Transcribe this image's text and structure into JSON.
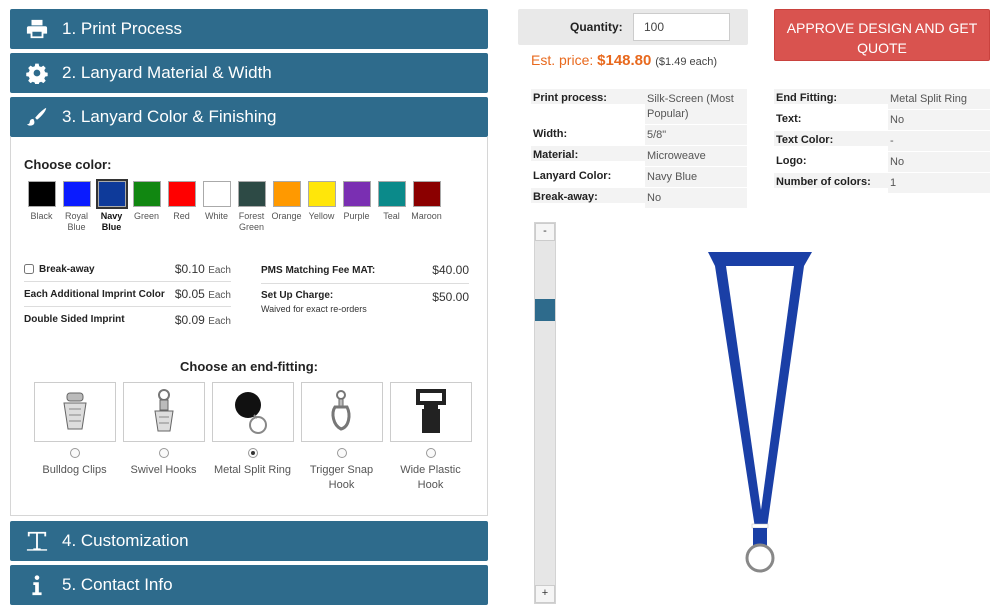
{
  "sections": [
    {
      "number_label": "1. Print Process",
      "icon": "printer-icon"
    },
    {
      "number_label": "2. Lanyard Material & Width",
      "icon": "gear-icon"
    },
    {
      "number_label": "3. Lanyard Color & Finishing",
      "icon": "brush-icon"
    },
    {
      "number_label": "4. Customization",
      "icon": "text-icon"
    },
    {
      "number_label": "5. Contact Info",
      "icon": "info-icon"
    }
  ],
  "color_section": {
    "choose_color_label": "Choose color:",
    "colors": [
      {
        "name": "Black",
        "hex": "#000000"
      },
      {
        "name": "Royal Blue",
        "hex": "#0a1bff"
      },
      {
        "name": "Navy Blue",
        "hex": "#0e3a9a",
        "selected": true
      },
      {
        "name": "Green",
        "hex": "#118711"
      },
      {
        "name": "Red",
        "hex": "#ff0000"
      },
      {
        "name": "White",
        "hex": "#ffffff"
      },
      {
        "name": "Forest Green",
        "hex": "#2d4a45"
      },
      {
        "name": "Orange",
        "hex": "#ff9900"
      },
      {
        "name": "Yellow",
        "hex": "#ffe60a"
      },
      {
        "name": "Purple",
        "hex": "#7a2fb2"
      },
      {
        "name": "Teal",
        "hex": "#0b8a8a"
      },
      {
        "name": "Maroon",
        "hex": "#8b0000"
      }
    ]
  },
  "fees": {
    "breakaway": {
      "label": "Break-away",
      "amount": "$0.10",
      "unit": "Each"
    },
    "additional_imprint": {
      "label": "Each Additional Imprint Color",
      "amount": "$0.05",
      "unit": "Each"
    },
    "double_sided": {
      "label": "Double Sided Imprint",
      "amount": "$0.09",
      "unit": "Each"
    },
    "pms": {
      "label": "PMS Matching Fee MAT:",
      "amount": "$40.00"
    },
    "setup": {
      "label": "Set Up Charge:",
      "sub": "Waived for exact re-orders",
      "amount": "$50.00"
    }
  },
  "end_fitting": {
    "label": "Choose an end-fitting:",
    "options": [
      {
        "name_line1": "Bulldog Clips",
        "name_line2": "",
        "selected": false
      },
      {
        "name_line1": "Swivel Hooks",
        "name_line2": "",
        "selected": false
      },
      {
        "name_line1": "Metal Split Ring",
        "name_line2": "",
        "selected": true
      },
      {
        "name_line1": "Trigger Snap",
        "name_line2": "Hook",
        "selected": false
      },
      {
        "name_line1": "Wide Plastic",
        "name_line2": "Hook",
        "selected": false
      }
    ]
  },
  "quantity": {
    "label": "Quantity:",
    "value": "100"
  },
  "estimate": {
    "label": "Est. price:",
    "total": "$148.80",
    "each": "($1.49 each)"
  },
  "approve_button": {
    "line1": "APPROVE DESIGN AND GET",
    "line2": "QUOTE"
  },
  "specs_left": [
    {
      "key": "Print process:",
      "value": "Silk-Screen (Most Popular)"
    },
    {
      "key": "Width:",
      "value": "5/8\""
    },
    {
      "key": "Material:",
      "value": "Microweave"
    },
    {
      "key": "Lanyard Color:",
      "value": "Navy Blue"
    },
    {
      "key": "Break-away:",
      "value": "No"
    }
  ],
  "specs_right": [
    {
      "key": "End Fitting:",
      "value": "Metal Split Ring"
    },
    {
      "key": "Text:",
      "value": "No"
    },
    {
      "key": "Text Color:",
      "value": "-"
    },
    {
      "key": "Logo:",
      "value": "No"
    },
    {
      "key": "Number of colors:",
      "value": "1"
    }
  ],
  "zoom": {
    "minus": "-",
    "plus": "+"
  },
  "preview": {
    "lanyard_color": "#1a3fa6"
  }
}
